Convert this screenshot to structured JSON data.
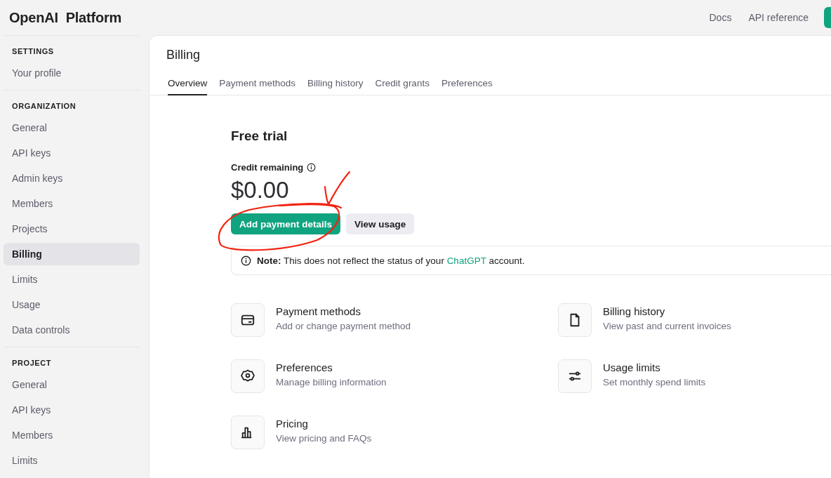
{
  "header": {
    "logo": "OpenAI  Platform",
    "links": [
      "Docs",
      "API reference"
    ]
  },
  "sidebar": {
    "sections": [
      {
        "heading": "SETTINGS",
        "items": [
          {
            "label": "Your profile",
            "selected": false
          }
        ]
      },
      {
        "heading": "ORGANIZATION",
        "items": [
          {
            "label": "General",
            "selected": false
          },
          {
            "label": "API keys",
            "selected": false
          },
          {
            "label": "Admin keys",
            "selected": false
          },
          {
            "label": "Members",
            "selected": false
          },
          {
            "label": "Projects",
            "selected": false
          },
          {
            "label": "Billing",
            "selected": true
          },
          {
            "label": "Limits",
            "selected": false
          },
          {
            "label": "Usage",
            "selected": false
          },
          {
            "label": "Data controls",
            "selected": false
          }
        ]
      },
      {
        "heading": "PROJECT",
        "items": [
          {
            "label": "General",
            "selected": false
          },
          {
            "label": "API keys",
            "selected": false
          },
          {
            "label": "Members",
            "selected": false
          },
          {
            "label": "Limits",
            "selected": false
          }
        ]
      }
    ]
  },
  "page": {
    "title": "Billing",
    "tabs": [
      {
        "label": "Overview",
        "selected": true
      },
      {
        "label": "Payment methods",
        "selected": false
      },
      {
        "label": "Billing history",
        "selected": false
      },
      {
        "label": "Credit grants",
        "selected": false
      },
      {
        "label": "Preferences",
        "selected": false
      }
    ],
    "plan": "Free trial",
    "credit_label": "Credit remaining",
    "credit_amount": "$0.00",
    "buttons": [
      {
        "label": "Add payment details",
        "kind": "primary"
      },
      {
        "label": "View usage",
        "kind": "secondary"
      }
    ],
    "note": "**Note:** This does not reflect the status of your ",
    "note_link": "ChatGPT",
    "note_end": " account.",
    "links": [
      {
        "kind": "card",
        "title": "Payment methods",
        "description": "Add or change payment method"
      },
      {
        "kind": "file",
        "title": "Billing history",
        "description": "View past and current invoices"
      },
      {
        "kind": "gear",
        "title": "Preferences",
        "description": "Manage billing information"
      },
      {
        "kind": "sliders",
        "title": "Usage limits",
        "description": "Set monthly spend limits"
      },
      {
        "kind": "chart",
        "title": "Pricing",
        "description": "View pricing and FAQs"
      }
    ]
  }
}
